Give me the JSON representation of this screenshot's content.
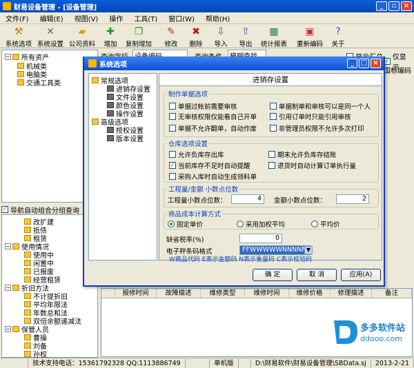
{
  "app": {
    "title": "财易设备管理 - [设备管理]"
  },
  "menu": [
    "文件(F)",
    "编辑(E)",
    "视图(V)",
    "操作",
    "工具(T)",
    "窗口(W)",
    "帮助(H)"
  ],
  "toolbar": [
    {
      "label": "系统选项",
      "icon": "hammer-icon"
    },
    {
      "label": "系统设置",
      "icon": "tools-icon"
    },
    {
      "label": "公司资料",
      "icon": "folder-icon"
    },
    {
      "label": "增加",
      "icon": "plus-icon"
    },
    {
      "label": "复制增加",
      "icon": "copy-plus-icon"
    },
    {
      "label": "修改",
      "icon": "pencil-icon"
    },
    {
      "label": "删除",
      "icon": "x-icon"
    },
    {
      "label": "导入",
      "icon": "import-icon"
    },
    {
      "label": "导出",
      "icon": "export-icon"
    },
    {
      "label": "统计报表",
      "icon": "chart-icon"
    },
    {
      "label": "重新编码",
      "icon": "recode-icon"
    },
    {
      "label": "关于",
      "icon": "help-icon"
    }
  ],
  "left_tree": {
    "root": "所有资产",
    "children": [
      "机械类",
      "电脑类",
      "交通工具类"
    ]
  },
  "nav_group": {
    "checkbox_label": "导航自动组合分组查询",
    "groups": [
      {
        "items": [
          "改扩建",
          "抵债",
          "租赁"
        ]
      },
      {
        "title": "使用情况",
        "items": [
          "使用中",
          "闲置中",
          "已报废",
          "经营租赁"
        ]
      },
      {
        "title": "折旧方法",
        "items": [
          "不计提折旧",
          "平均年限法",
          "年数总和法",
          "双倍余额递减法"
        ]
      },
      {
        "title": "保管人员",
        "items": [
          "曹操",
          "刘备",
          "孙权"
        ]
      }
    ]
  },
  "right_top": {
    "query_field_label": "查询字段",
    "query_field_value": "设备编码",
    "query_cond_label": "查询条件",
    "query_cond_value": "模糊查找",
    "show_summary": "显示汇总",
    "only_show": "仅显示",
    "asset_code": "国标编码"
  },
  "grid": {
    "columns": [
      "报修时间",
      "故障描述",
      "维修类型",
      "维修时间",
      "维修价格",
      "修理描述",
      "备注"
    ]
  },
  "status": {
    "support": "技术支持电话：15361792328 QQ:1113886749",
    "mode": "单机版",
    "path": "D:\\财易软件\\财易设备管理\\SBData.sj",
    "date": "2013-2-21"
  },
  "dialog": {
    "title": "系统选项",
    "tree": {
      "general": "常规选项",
      "general_items": [
        "进销存设置",
        "文件设置",
        "颜色设置",
        "操作设置"
      ],
      "advanced": "高级选项",
      "advanced_items": [
        "授权设置",
        "版本设置"
      ]
    },
    "panel_title": "进销存设置",
    "doc_options": {
      "legend": "制作单据选项",
      "items": [
        {
          "label": "单据过帐前需要审核",
          "checked": false
        },
        {
          "label": "单据制单和审核可以是同一个人",
          "checked": false
        },
        {
          "label": "无审核权限仅能看自己开单",
          "checked": false
        },
        {
          "label": "引用订单时只能引用审核",
          "checked": false
        },
        {
          "label": "单据不允许翻单，自动作废",
          "checked": false
        },
        {
          "label": "非管理员权限不允许多次打印",
          "checked": false
        }
      ]
    },
    "warehouse_options": {
      "legend": "仓库选项设置",
      "items": [
        {
          "label": "允许负库存出库",
          "checked": false
        },
        {
          "label": "期末允许负库存结账",
          "checked": false
        },
        {
          "label": "当前库存不足时自动提醒",
          "checked": true
        },
        {
          "label": "退货时自动计算订单执行量",
          "checked": false
        },
        {
          "label": "采购入库时自动生成领料单",
          "checked": false
        }
      ]
    },
    "decimal": {
      "legend": "工程量/金额 小数点位数",
      "qty_label": "工程量小数点位数：",
      "qty_value": "4",
      "amt_label": "金额小数点位数：",
      "amt_value": "2"
    },
    "cost": {
      "legend": "商品成本计算方式",
      "options": [
        {
          "label": "固定单价",
          "selected": true
        },
        {
          "label": "采用加权平均",
          "selected": false
        },
        {
          "label": "平均价",
          "selected": false
        }
      ]
    },
    "tax_label": "缺省税率(%)",
    "tax_value": "0",
    "barcode_label": "电子秤条码格式",
    "barcode_value": "FFWWWWWNNNNNC",
    "barcode_hint": "W商品代码 E表示金额码 N表示重量码 C表示校验码",
    "buttons": {
      "ok": "确  定",
      "cancel": "取  消",
      "apply": "应用(A)"
    }
  },
  "watermark": {
    "brand": "多多软件站",
    "url": "ddooo.com"
  }
}
